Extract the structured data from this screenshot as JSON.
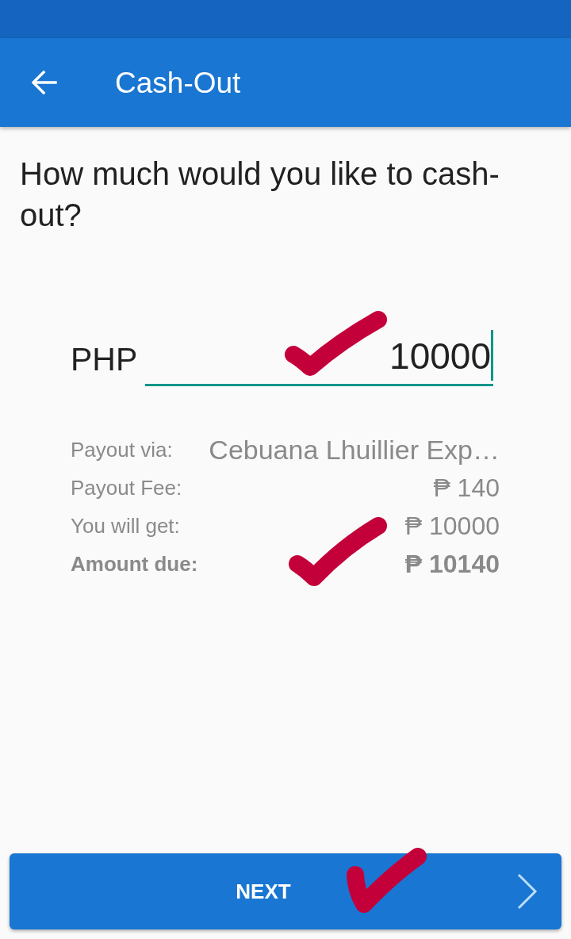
{
  "app_bar": {
    "title": "Cash-Out"
  },
  "question": "How much would you like to cash-out?",
  "amount": {
    "currency": "PHP",
    "value": "10000"
  },
  "summary": [
    {
      "kind": "provider",
      "label": "Payout via:",
      "value": "Cebuana Lhuillier Exp…"
    },
    {
      "kind": "normal",
      "label": "Payout Fee:",
      "value": "₱ 140"
    },
    {
      "kind": "normal",
      "label": "You will get:",
      "value": "₱ 10000"
    },
    {
      "kind": "total",
      "label": "Amount due:",
      "value": "₱ 10140"
    }
  ],
  "next_button": {
    "label": "NEXT"
  }
}
